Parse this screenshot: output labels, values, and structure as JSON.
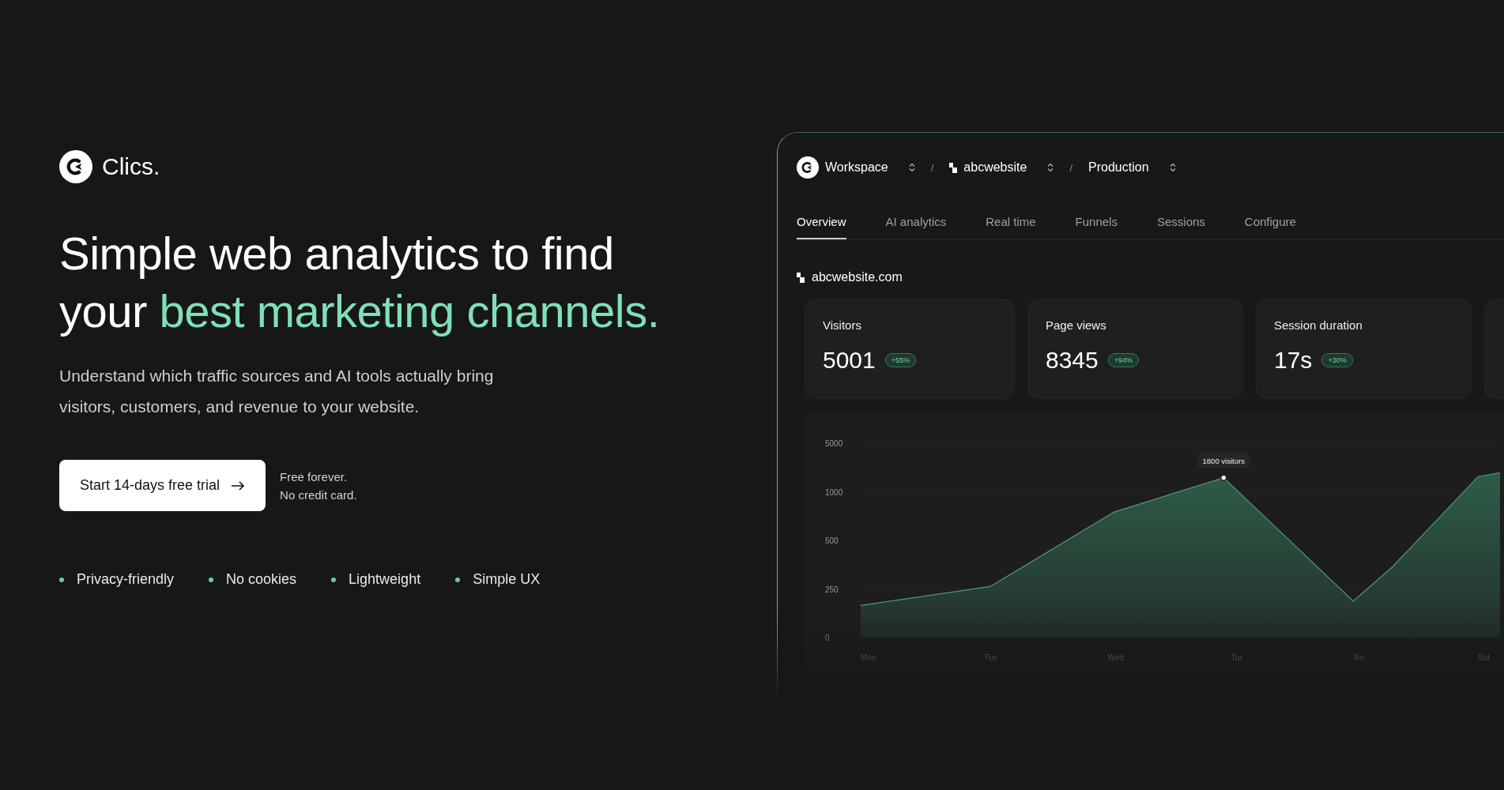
{
  "brand": {
    "name": "Clics."
  },
  "hero": {
    "headline": [
      {
        "text": "Simple web analytics to find your ",
        "highlight": false
      },
      {
        "text": "best marketing channels.",
        "highlight": true
      }
    ],
    "subtitle": "Understand which traffic sources and AI tools actually bring visitors, customers, and revenue to your website.",
    "cta": {
      "label": "Start 14-days free trial"
    },
    "cta_note": [
      "Free forever.",
      "No credit card."
    ],
    "features": [
      "Privacy-friendly",
      "No cookies",
      "Lightweight",
      "Simple UX"
    ]
  },
  "dashboard": {
    "separator": "/",
    "breadcrumbs": [
      {
        "label": "Workspace",
        "kind": "logo"
      },
      {
        "label": "abcwebsite",
        "kind": "site"
      },
      {
        "label": "Production",
        "kind": "plain"
      }
    ],
    "tabs": [
      {
        "label": "Overview",
        "selected": true
      },
      {
        "label": "AI analytics",
        "selected": false
      },
      {
        "label": "Real time",
        "selected": false
      },
      {
        "label": "Funnels",
        "selected": false
      },
      {
        "label": "Sessions",
        "selected": false
      },
      {
        "label": "Configure",
        "selected": false
      }
    ],
    "site": "abcwebsite.com",
    "stats": [
      {
        "label": "Visitors",
        "value": "5001",
        "change": "+55%"
      },
      {
        "label": "Page views",
        "value": "8345",
        "change": "+94%"
      },
      {
        "label": "Session duration",
        "value": "17s",
        "change": "+30%"
      }
    ],
    "chart": {
      "y_labels": [
        "5000",
        "1000",
        "500",
        "250",
        "0"
      ],
      "x_labels": [
        "Mon",
        "Tue",
        "Wed",
        "Tur",
        "Fri",
        "Sat"
      ],
      "tooltip": "1800 visitors"
    }
  }
}
